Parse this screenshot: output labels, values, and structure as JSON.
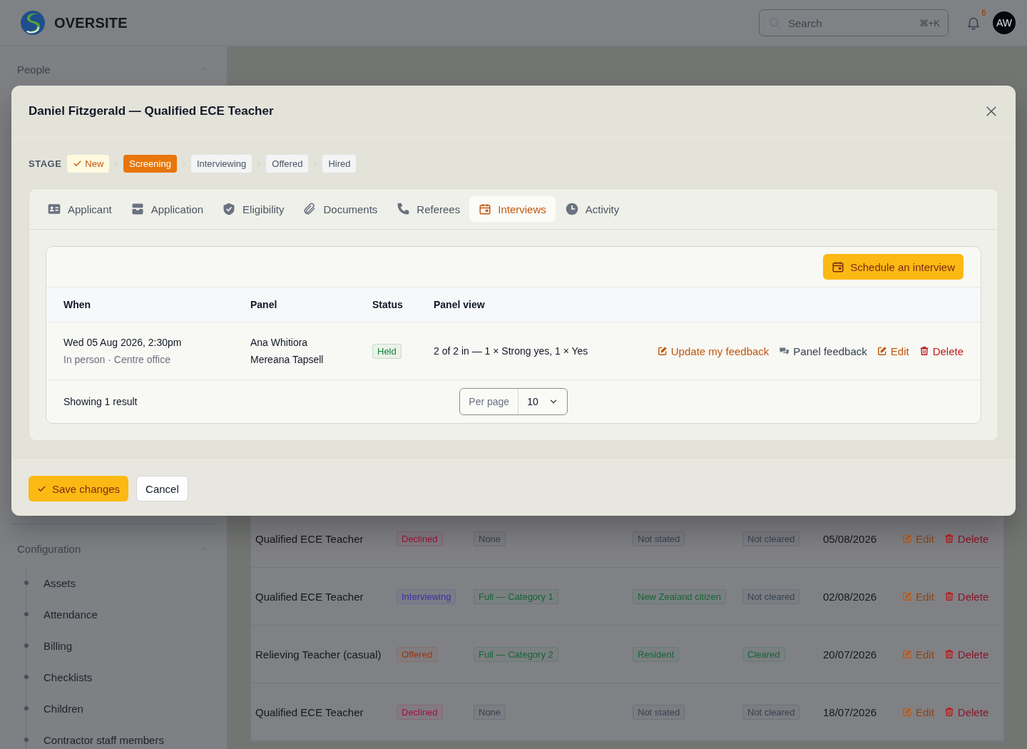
{
  "header": {
    "logo_text": "OVERSITE",
    "search": {
      "placeholder": "Search",
      "shortcut": "⌘+K"
    },
    "notification_count": "6",
    "avatar": "AW"
  },
  "sidebar": {
    "sections": [
      {
        "title": "People",
        "expanded": true
      },
      {
        "title": "Configuration",
        "expanded": true,
        "items": [
          "Assets",
          "Attendance",
          "Billing",
          "Checklists",
          "Children",
          "Contractor staff members"
        ]
      }
    ]
  },
  "page": {
    "rows": [
      {
        "role": "Qualified ECE Teacher",
        "badges": [
          {
            "label": "Declined",
            "color": "#9f1239"
          },
          {
            "label": "None",
            "color": "#374151"
          },
          {
            "label": "Not stated",
            "color": "#374151"
          },
          {
            "label": "Not cleared",
            "color": "#374151"
          }
        ],
        "date": "05/08/2026",
        "actions": [
          {
            "kind": "edit",
            "label": "Edit"
          },
          {
            "kind": "delete",
            "label": "Delete"
          }
        ]
      },
      {
        "role": "Qualified ECE Teacher",
        "badges": [
          {
            "label": "Interviewing",
            "color": "#3730a3"
          },
          {
            "label": "Full — Category 1",
            "color": "#166534"
          },
          {
            "label": "New Zealand citizen",
            "color": "#166534"
          },
          {
            "label": "Not cleared",
            "color": "#374151"
          }
        ],
        "date": "02/08/2026",
        "actions": [
          {
            "kind": "edit",
            "label": "Edit"
          },
          {
            "kind": "delete",
            "label": "Delete"
          }
        ]
      },
      {
        "role": "Relieving Teacher (casual)",
        "badges": [
          {
            "label": "Offered",
            "color": "#9a3412"
          },
          {
            "label": "Full — Category 2",
            "color": "#166534"
          },
          {
            "label": "Resident",
            "color": "#166534"
          },
          {
            "label": "Cleared",
            "color": "#166534"
          }
        ],
        "date": "20/07/2026",
        "actions": [
          {
            "kind": "edit",
            "label": "Edit"
          },
          {
            "kind": "delete",
            "label": "Delete"
          }
        ]
      },
      {
        "role": "Qualified ECE Teacher",
        "badges": [
          {
            "label": "Declined",
            "color": "#9f1239"
          },
          {
            "label": "None",
            "color": "#374151"
          },
          {
            "label": "Not stated",
            "color": "#374151"
          },
          {
            "label": "Not cleared",
            "color": "#374151"
          }
        ],
        "date": "18/07/2026",
        "actions": [
          {
            "kind": "edit",
            "label": "Edit"
          },
          {
            "kind": "delete",
            "label": "Delete"
          }
        ]
      }
    ]
  },
  "modal": {
    "title": "Daniel Fitzgerald — Qualified ECE Teacher",
    "stage_label": "STAGE",
    "stages": [
      {
        "label": "New",
        "completed": true,
        "selected": false
      },
      {
        "label": "Screening",
        "completed": false,
        "selected": true
      },
      {
        "label": "Interviewing",
        "completed": false,
        "selected": false
      },
      {
        "label": "Offered",
        "completed": false,
        "selected": false
      },
      {
        "label": "Hired",
        "completed": false,
        "selected": false
      }
    ],
    "tabs": [
      {
        "label": "Applicant",
        "selected": false
      },
      {
        "label": "Application",
        "selected": false
      },
      {
        "label": "Eligibility",
        "selected": false
      },
      {
        "label": "Documents",
        "selected": false
      },
      {
        "label": "Referees",
        "selected": false
      },
      {
        "label": "Interviews",
        "selected": true
      },
      {
        "label": "Activity",
        "selected": false
      }
    ],
    "interviews": {
      "schedule_button": "Schedule an interview",
      "columns": [
        "When",
        "Panel",
        "Status",
        "Panel view"
      ],
      "rows": [
        {
          "when": "Wed 05 Aug 2026, 2:30pm",
          "where": "In person · Centre office",
          "panel": [
            "Ana Whitiora",
            "Mereana Tapsell"
          ],
          "status": {
            "label": "Held",
            "color": "#15803d"
          },
          "panel_view": "2 of 2 in — 1 × Strong yes, 1 × Yes",
          "actions": [
            {
              "kind": "feedback",
              "label": "Update my feedback"
            },
            {
              "kind": "panel",
              "label": "Panel feedback"
            },
            {
              "kind": "edit",
              "label": "Edit"
            },
            {
              "kind": "delete",
              "label": "Delete"
            }
          ]
        }
      ],
      "footer": {
        "summary": "Showing 1 result",
        "per_page_label": "Per page",
        "per_page_value": "10"
      }
    },
    "buttons": [
      {
        "kind": "primary",
        "label": "Save changes"
      },
      {
        "kind": "secondary",
        "label": "Cancel"
      }
    ]
  }
}
